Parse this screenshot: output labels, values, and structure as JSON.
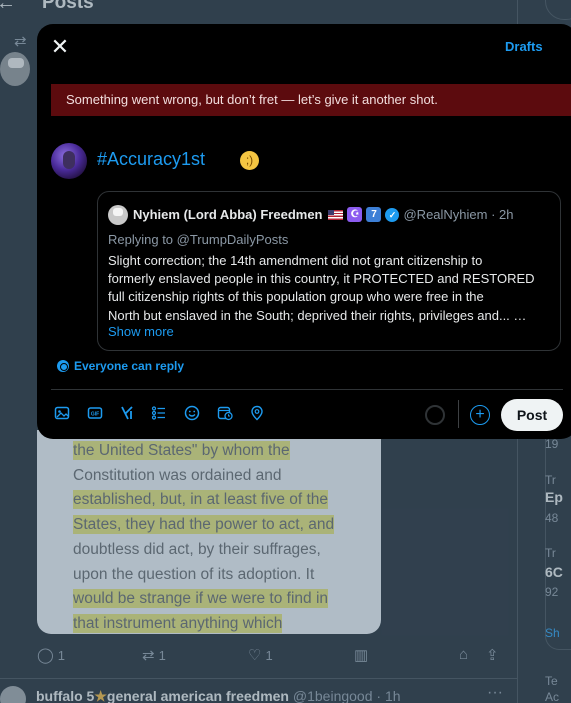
{
  "background": {
    "header_title": "Posts",
    "doc_lines": [
      {
        "text": "the United States\" by whom the",
        "highlight": true
      },
      {
        "text": "Constitution was ordained and",
        "highlight": false
      },
      {
        "text": "established, but, in at least five of the",
        "highlight": true
      },
      {
        "text": "States, they had the power to act, and",
        "highlight": true
      },
      {
        "text": "doubtless did act, by their suffrages,",
        "highlight": false
      },
      {
        "text": "upon the question of its adoption. It",
        "highlight": false
      },
      {
        "text": "would be strange if we were to find in",
        "highlight": true
      },
      {
        "text": "that instrument anything which",
        "highlight": true
      }
    ],
    "actions": {
      "reply_count": "1",
      "retweet_count": "1",
      "like_count": "1"
    },
    "next_post": {
      "name": "buffalo 5",
      "name_rest": "general american freedmen",
      "handle": "@1beingood · 1h"
    },
    "right_column": {
      "r1": "19",
      "r2": "Tr",
      "r3": "Ep",
      "r4": "48",
      "r5": "Tr",
      "r6": "6C",
      "r7": "92",
      "r8": "Sh",
      "r9": "Te",
      "r10": "Ac"
    }
  },
  "modal": {
    "drafts_label": "Drafts",
    "error_message": "Something went wrong, but don’t fret — let’s give it another shot.",
    "compose_text": "#Accuracy1st",
    "compose_emoji": "wink-emoji",
    "quote": {
      "name": "Nyhiem (Lord Abba) Freedmen",
      "badge1": "☪",
      "badge2": "7",
      "handle": "@RealNyhiem · 2h",
      "replying_to": "Replying to @TrumpDailyPosts",
      "body_lines": [
        "Slight correction; the 14th amendment did not grant citizenship to",
        "formerly enslaved people in this country, it PROTECTED and RESTORED",
        "full citizenship rights of this population group who were free in the",
        "North but enslaved in the South; deprived their rights, privileges and... …"
      ],
      "show_more": "Show more"
    },
    "reply_setting": "Everyone can reply",
    "post_label": "Post",
    "add_label": "+"
  },
  "colors": {
    "accent": "#1d9bf0",
    "error_bg": "#5c0b0e",
    "modal_bg": "#000000"
  }
}
